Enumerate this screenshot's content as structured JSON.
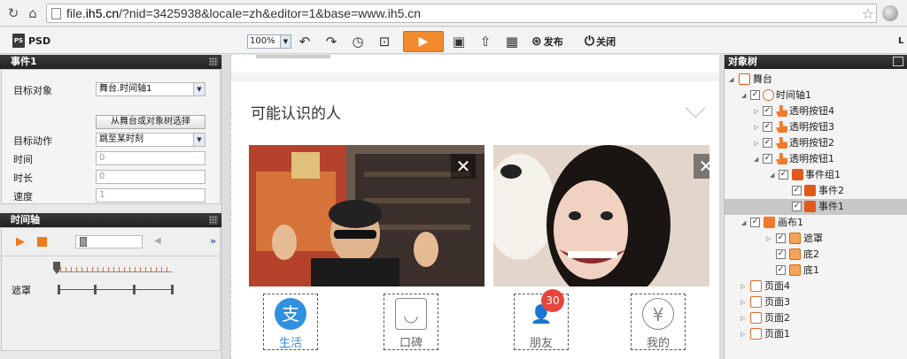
{
  "browser": {
    "url_prefix": "file.",
    "url_host": "ih5.cn",
    "url_rest": "/?nid=3425938&locale=zh&editor=1&base=www.ih5.cn"
  },
  "toolbar": {
    "psd_label": "PSD",
    "psd_icon_text": "PS",
    "zoom": "100%",
    "publish_label": "发布",
    "close_label": "关闭",
    "right_cut": "L"
  },
  "event_panel": {
    "title": "事件1",
    "rows": {
      "target_object_label": "目标对象",
      "target_object_value": "舞台.时间轴1",
      "pick_button": "从舞台或对象树选择",
      "target_action_label": "目标动作",
      "target_action_value": "跳至某时刻",
      "time_label": "时间",
      "time_value": "0",
      "duration_label": "时长",
      "duration_value": "0",
      "speed_label": "速度",
      "speed_value": "1"
    }
  },
  "timeline_panel": {
    "title": "时间轴",
    "more": "»",
    "track_name": "遮罩"
  },
  "stage": {
    "section_title": "可能认识的人",
    "tabs": [
      {
        "label": "生活",
        "icon_text": "支"
      },
      {
        "label": "口碑",
        "icon_text": "◡"
      },
      {
        "label": "朋友",
        "icon_text": "👤",
        "badge": "30"
      },
      {
        "label": "我的",
        "icon_text": "¥"
      }
    ]
  },
  "object_tree": {
    "title": "对象树",
    "items": [
      {
        "label": "舞台"
      },
      {
        "label": "时间轴1"
      },
      {
        "label": "透明按钮4"
      },
      {
        "label": "透明按钮3"
      },
      {
        "label": "透明按钮2"
      },
      {
        "label": "透明按钮1"
      },
      {
        "label": "事件组1"
      },
      {
        "label": "事件2"
      },
      {
        "label": "事件1"
      },
      {
        "label": "画布1"
      },
      {
        "label": "遮罩"
      },
      {
        "label": "底2"
      },
      {
        "label": "底1"
      },
      {
        "label": "页面4"
      },
      {
        "label": "页面3"
      },
      {
        "label": "页面2"
      },
      {
        "label": "页面1"
      }
    ]
  },
  "colors": {
    "accent_orange": "#f08a2c",
    "tab_active_blue": "#2f8fe0",
    "badge_red": "#e8453c"
  }
}
